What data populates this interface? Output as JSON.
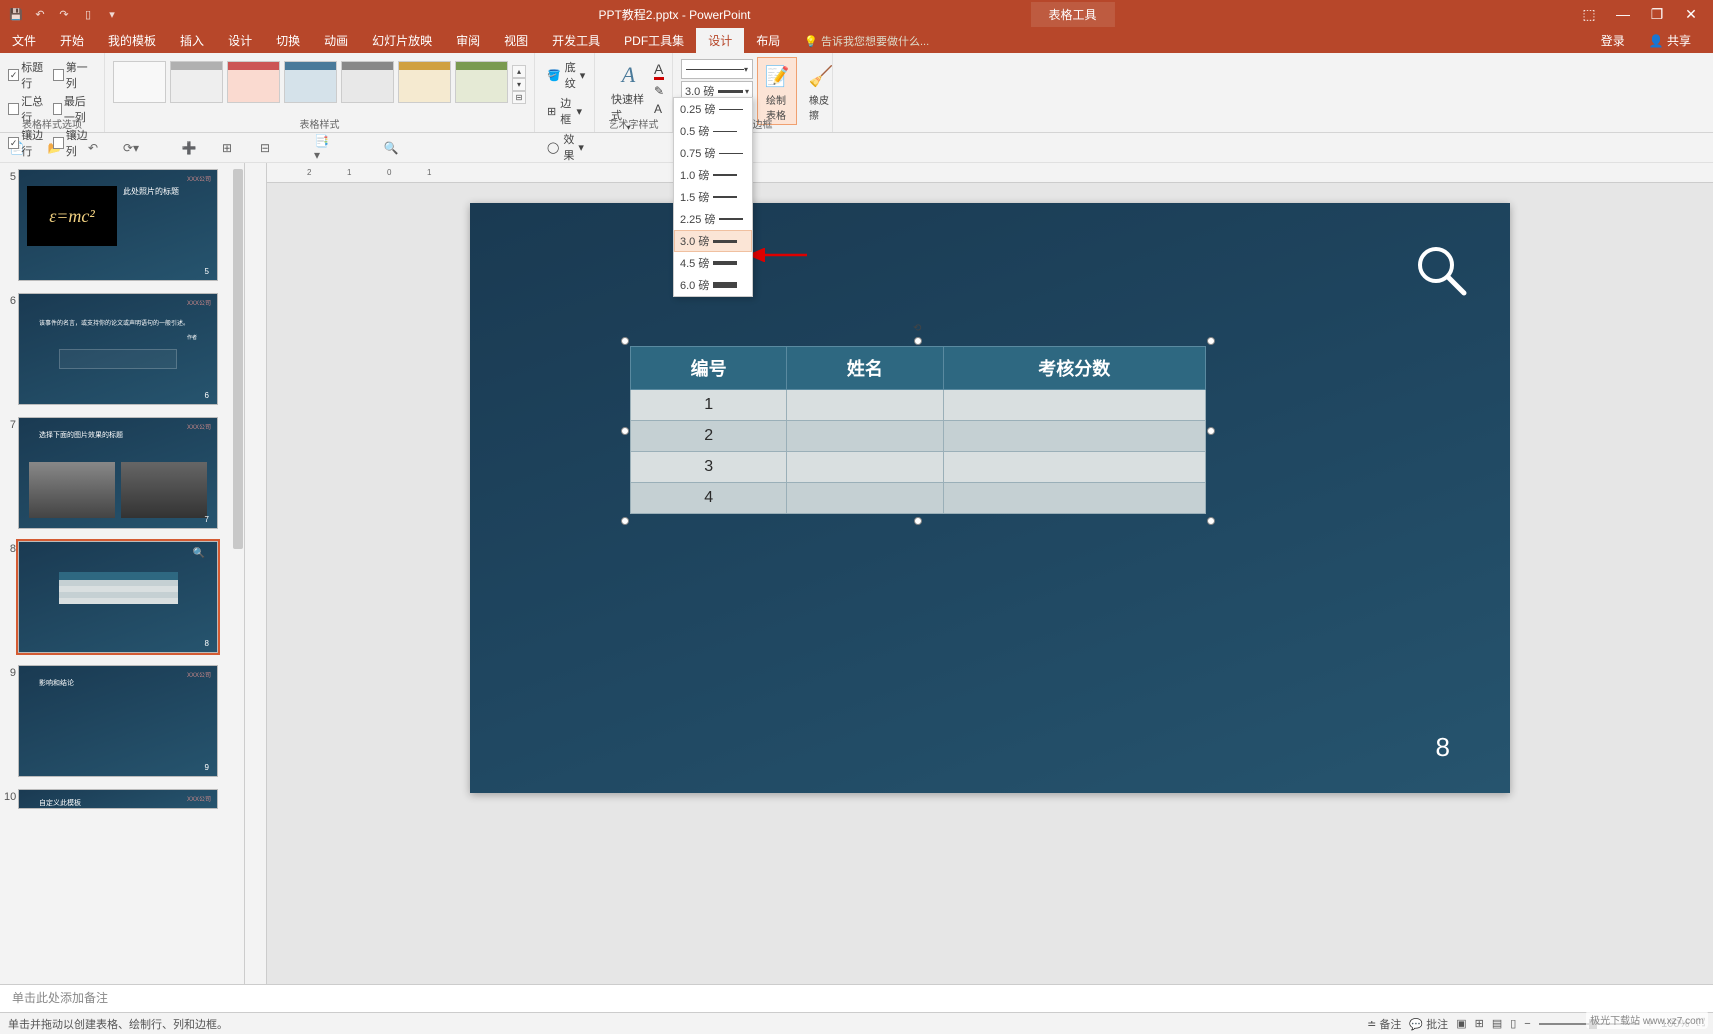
{
  "title": "PPT教程2.pptx - PowerPoint",
  "context_tab": "表格工具",
  "window_controls": {
    "settings": "⬚",
    "min": "—",
    "max": "❐",
    "close": "✕"
  },
  "menu": {
    "items": [
      "文件",
      "开始",
      "我的模板",
      "插入",
      "设计",
      "切换",
      "动画",
      "幻灯片放映",
      "审阅",
      "视图",
      "开发工具",
      "PDF工具集",
      "设计",
      "布局"
    ],
    "active_index": 12,
    "tell_me": "告诉我您想要做什么...",
    "login": "登录",
    "share": "共享"
  },
  "ribbon": {
    "style_options": {
      "label": "表格样式选项",
      "header_row": "标题行",
      "first_col": "第一列",
      "total_row": "汇总行",
      "last_col": "最后一列",
      "banded_rows": "镶边行",
      "banded_cols": "镶边列"
    },
    "table_styles": {
      "label": "表格样式",
      "shading": "底纹",
      "borders": "边框",
      "effects": "效果"
    },
    "wordart": {
      "label": "艺术字样式",
      "quick": "快速样式"
    },
    "draw_borders": {
      "label": "绘图边框",
      "pen_weight": "3.0 磅",
      "draw_table": "绘制表格",
      "eraser": "橡皮擦"
    },
    "weight_options": [
      "0.25 磅",
      "0.5 磅",
      "0.75 磅",
      "1.0 磅",
      "1.5 磅",
      "2.25 磅",
      "3.0 磅",
      "4.5 磅",
      "6.0 磅"
    ],
    "weight_selected_index": 6
  },
  "slides": [
    {
      "num": "5"
    },
    {
      "num": "6"
    },
    {
      "num": "7"
    },
    {
      "num": "8"
    },
    {
      "num": "9"
    },
    {
      "num": "10"
    }
  ],
  "slide_content": {
    "headers": [
      "编号",
      "姓名",
      "考核分数"
    ],
    "rows": [
      [
        "1",
        "",
        ""
      ],
      [
        "2",
        "",
        ""
      ],
      [
        "3",
        "",
        ""
      ],
      [
        "4",
        "",
        ""
      ]
    ],
    "page": "8"
  },
  "thumb_labels": {
    "formula": "ε=mc²",
    "s5_title": "此处照片的标题",
    "s6_quote": "该事件的名言，或支持你的论文或声明语句的一般引述。",
    "s6_author": "作者",
    "s7_title": "选择下面的图片效果的标题",
    "s9_title": "影响和结论",
    "s10_title": "自定义此模板",
    "logo": "XXX公司"
  },
  "notes_placeholder": "单击此处添加备注",
  "status": {
    "left": "单击并拖动以创建表格、绘制行、列和边框。",
    "notes": "备注",
    "comments": "批注",
    "zoom": "100%"
  },
  "watermark": "极光下载站 www.xz7.com"
}
